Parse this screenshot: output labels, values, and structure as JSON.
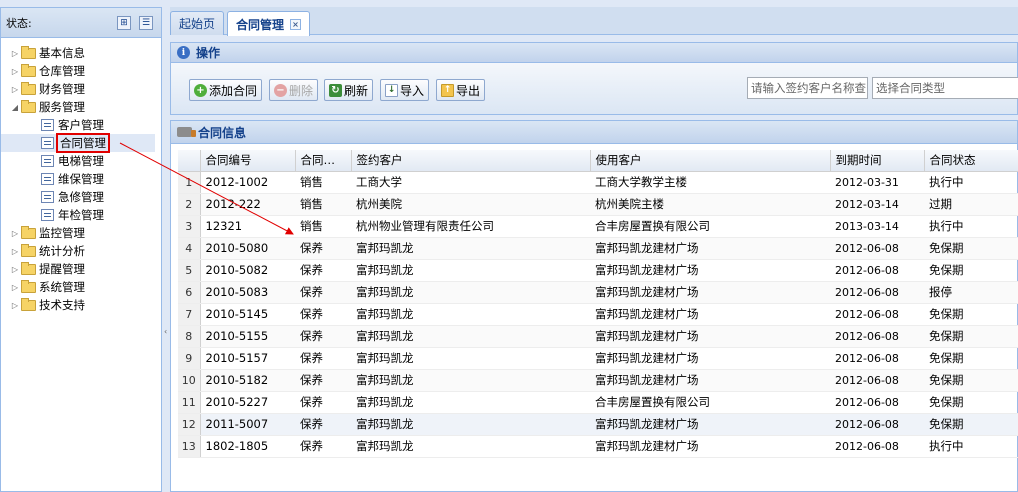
{
  "sidebar": {
    "title": "状态:",
    "items": [
      {
        "label": "基本信息",
        "level": 0,
        "type": "folder",
        "expanded": false
      },
      {
        "label": "仓库管理",
        "level": 0,
        "type": "folder",
        "expanded": false
      },
      {
        "label": "财务管理",
        "level": 0,
        "type": "folder",
        "expanded": false
      },
      {
        "label": "服务管理",
        "level": 0,
        "type": "folder",
        "expanded": true
      },
      {
        "label": "客户管理",
        "level": 1,
        "type": "doc"
      },
      {
        "label": "合同管理",
        "level": 1,
        "type": "doc",
        "selected": true
      },
      {
        "label": "电梯管理",
        "level": 1,
        "type": "doc"
      },
      {
        "label": "维保管理",
        "level": 1,
        "type": "doc"
      },
      {
        "label": "急修管理",
        "level": 1,
        "type": "doc"
      },
      {
        "label": "年检管理",
        "level": 1,
        "type": "doc"
      },
      {
        "label": "监控管理",
        "level": 0,
        "type": "folder",
        "expanded": false
      },
      {
        "label": "统计分析",
        "level": 0,
        "type": "folder",
        "expanded": false
      },
      {
        "label": "提醒管理",
        "level": 0,
        "type": "folder",
        "expanded": false
      },
      {
        "label": "系统管理",
        "level": 0,
        "type": "folder",
        "expanded": false
      },
      {
        "label": "技术支持",
        "level": 0,
        "type": "folder",
        "expanded": false
      }
    ]
  },
  "tabs": [
    {
      "label": "起始页",
      "active": false
    },
    {
      "label": "合同管理",
      "active": true,
      "close": "×"
    }
  ],
  "operations": {
    "title": "操作",
    "buttons": {
      "add": "添加合同",
      "delete": "删除",
      "refresh": "刷新",
      "import": "导入",
      "export": "导出"
    },
    "search_placeholder": "请输入签约客户名称查",
    "type_placeholder": "选择合同类型"
  },
  "grid": {
    "title": "合同信息",
    "columns": [
      "合同编号",
      "合同…",
      "签约客户",
      "使用客户",
      "到期时间",
      "合同状态"
    ],
    "rows": [
      [
        "1",
        "2012-1002",
        "销售",
        "工商大学",
        "工商大学教学主楼",
        "2012-03-31",
        "执行中"
      ],
      [
        "2",
        "2012-222",
        "销售",
        "杭州美院",
        "杭州美院主楼",
        "2012-03-14",
        "过期"
      ],
      [
        "3",
        "12321",
        "销售",
        "杭州物业管理有限责任公司",
        "合丰房屋置换有限公司",
        "2013-03-14",
        "执行中"
      ],
      [
        "4",
        "2010-5080",
        "保养",
        "富邦玛凯龙",
        "富邦玛凯龙建材广场",
        "2012-06-08",
        "免保期"
      ],
      [
        "5",
        "2010-5082",
        "保养",
        "富邦玛凯龙",
        "富邦玛凯龙建材广场",
        "2012-06-08",
        "免保期"
      ],
      [
        "6",
        "2010-5083",
        "保养",
        "富邦玛凯龙",
        "富邦玛凯龙建材广场",
        "2012-06-08",
        "报停"
      ],
      [
        "7",
        "2010-5145",
        "保养",
        "富邦玛凯龙",
        "富邦玛凯龙建材广场",
        "2012-06-08",
        "免保期"
      ],
      [
        "8",
        "2010-5155",
        "保养",
        "富邦玛凯龙",
        "富邦玛凯龙建材广场",
        "2012-06-08",
        "免保期"
      ],
      [
        "9",
        "2010-5157",
        "保养",
        "富邦玛凯龙",
        "富邦玛凯龙建材广场",
        "2012-06-08",
        "免保期"
      ],
      [
        "10",
        "2010-5182",
        "保养",
        "富邦玛凯龙",
        "富邦玛凯龙建材广场",
        "2012-06-08",
        "免保期"
      ],
      [
        "11",
        "2010-5227",
        "保养",
        "富邦玛凯龙",
        "合丰房屋置换有限公司",
        "2012-06-08",
        "免保期"
      ],
      [
        "12",
        "2011-5007",
        "保养",
        "富邦玛凯龙",
        "富邦玛凯龙建材广场",
        "2012-06-08",
        "免保期"
      ],
      [
        "13",
        "1802-1805",
        "保养",
        "富邦玛凯龙",
        "富邦玛凯龙建材广场",
        "2012-06-08",
        "执行中"
      ]
    ]
  },
  "colors": {
    "border": "#99bbe8",
    "header_bg": "#dfe8f6",
    "title_text": "#15428b",
    "annotation": "#e10000"
  }
}
